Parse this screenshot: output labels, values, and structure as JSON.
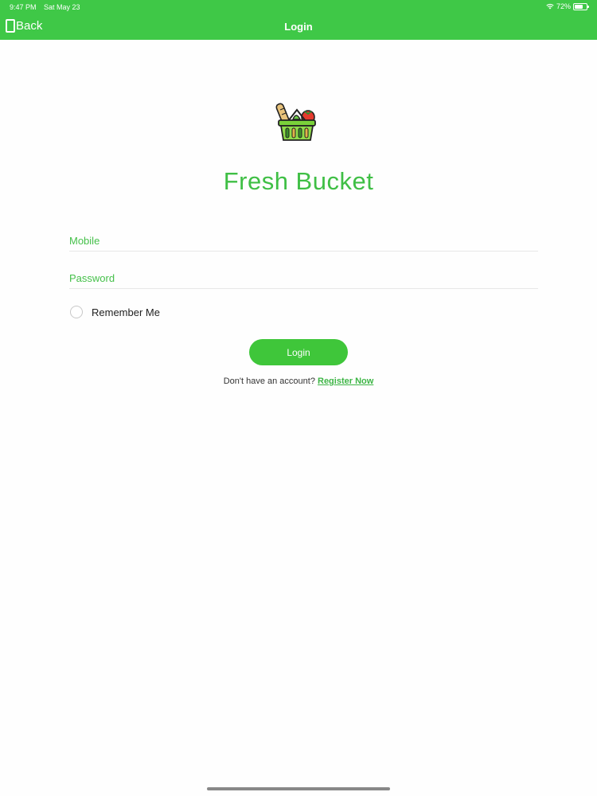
{
  "status_bar": {
    "time": "9:47 PM",
    "date": "Sat May 23",
    "battery": "72%",
    "battery_level": 0.72
  },
  "nav": {
    "back_label": "Back",
    "title": "Login"
  },
  "app": {
    "name": "Fresh Bucket",
    "logo_icon": "grocery-basket-icon"
  },
  "form": {
    "mobile_placeholder": "Mobile",
    "mobile_value": "",
    "password_placeholder": "Password",
    "password_value": "",
    "remember_label": "Remember Me",
    "remember_checked": false,
    "login_label": "Login"
  },
  "signup": {
    "prompt": "Don't have an account? ",
    "link": "Register Now"
  },
  "colors": {
    "brand_green": "#3fc847",
    "link_green": "#3db545"
  }
}
